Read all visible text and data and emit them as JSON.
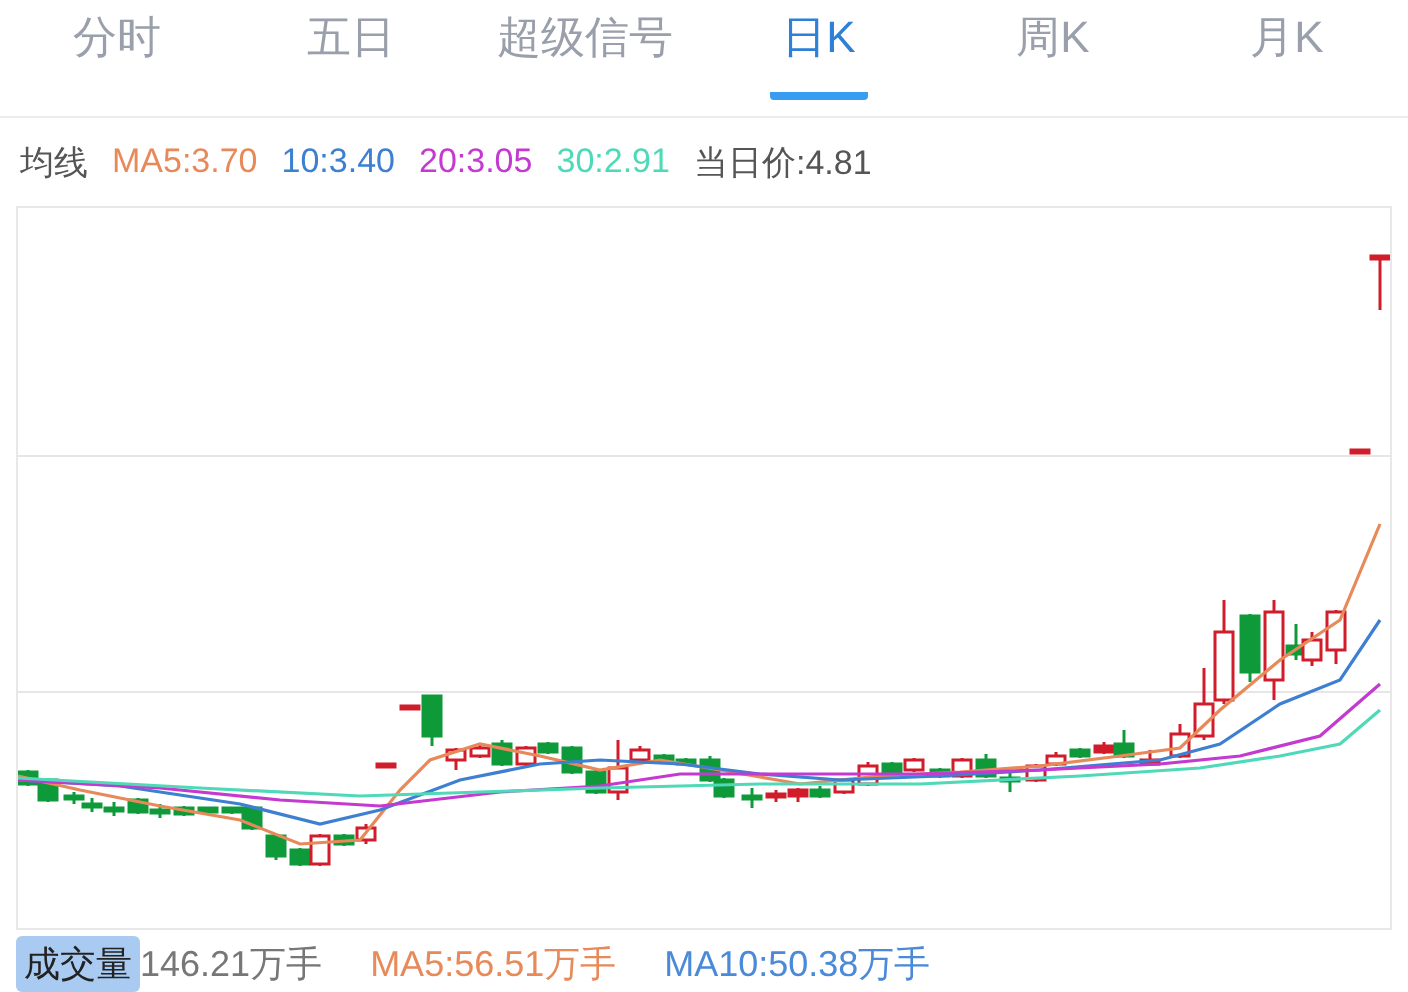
{
  "tabs": [
    {
      "label": "分时",
      "selected": false
    },
    {
      "label": "五日",
      "selected": false
    },
    {
      "label": "超级信号",
      "selected": false
    },
    {
      "label": "日K",
      "selected": true
    },
    {
      "label": "周K",
      "selected": false
    },
    {
      "label": "月K",
      "selected": false
    }
  ],
  "ma_legend": {
    "title": "均线",
    "items": [
      {
        "text": "MA5:3.70",
        "color": "#e8895a"
      },
      {
        "text": "10:3.40",
        "color": "#3d7fd0"
      },
      {
        "text": "20:3.05",
        "color": "#c43ad0"
      },
      {
        "text": "30:2.91",
        "color": "#4fd9b8"
      }
    ],
    "price": "当日价:4.81"
  },
  "volume_bar": {
    "label": "成交量",
    "volume": "146.21万手",
    "items": [
      {
        "text": "MA5:56.51万手",
        "color": "#e8895a"
      },
      {
        "text": "MA10:50.38万手",
        "color": "#4a8ad8"
      }
    ]
  }
}
